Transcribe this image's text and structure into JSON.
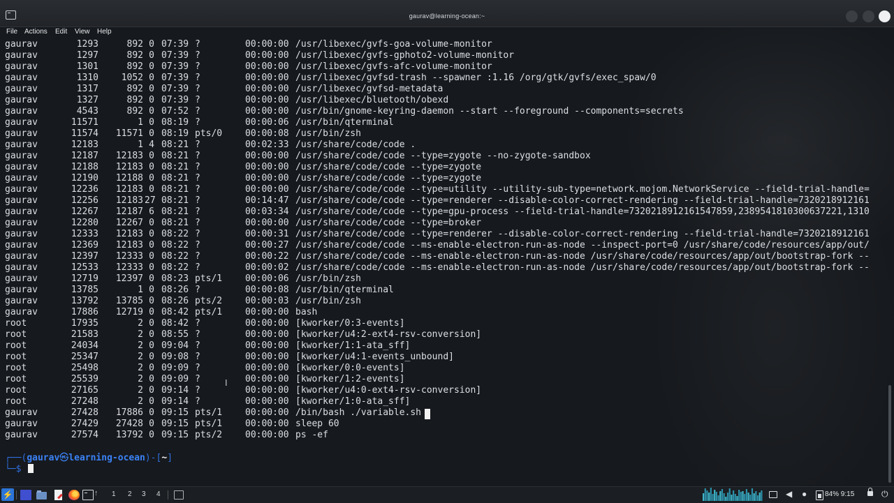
{
  "window": {
    "title": "gaurav@learning-ocean:~"
  },
  "menu": [
    "File",
    "Actions",
    "Edit",
    "View",
    "Help"
  ],
  "ps_rows": [
    [
      "gaurav",
      "1293",
      "892",
      "0",
      "07:39",
      "?",
      "00:00:00",
      "/usr/libexec/gvfs-goa-volume-monitor"
    ],
    [
      "gaurav",
      "1297",
      "892",
      "0",
      "07:39",
      "?",
      "00:00:00",
      "/usr/libexec/gvfs-gphoto2-volume-monitor"
    ],
    [
      "gaurav",
      "1301",
      "892",
      "0",
      "07:39",
      "?",
      "00:00:00",
      "/usr/libexec/gvfs-afc-volume-monitor"
    ],
    [
      "gaurav",
      "1310",
      "1052",
      "0",
      "07:39",
      "?",
      "00:00:00",
      "/usr/libexec/gvfsd-trash --spawner :1.16 /org/gtk/gvfs/exec_spaw/0"
    ],
    [
      "gaurav",
      "1317",
      "892",
      "0",
      "07:39",
      "?",
      "00:00:00",
      "/usr/libexec/gvfsd-metadata"
    ],
    [
      "gaurav",
      "1327",
      "892",
      "0",
      "07:39",
      "?",
      "00:00:00",
      "/usr/libexec/bluetooth/obexd"
    ],
    [
      "gaurav",
      "4543",
      "892",
      "0",
      "07:52",
      "?",
      "00:00:00",
      "/usr/bin/gnome-keyring-daemon --start --foreground --components=secrets"
    ],
    [
      "gaurav",
      "11571",
      "1",
      "0",
      "08:19",
      "?",
      "00:00:06",
      "/usr/bin/qterminal"
    ],
    [
      "gaurav",
      "11574",
      "11571",
      "0",
      "08:19",
      "pts/0",
      "00:00:08",
      "/usr/bin/zsh"
    ],
    [
      "gaurav",
      "12183",
      "1",
      "4",
      "08:21",
      "?",
      "00:02:33",
      "/usr/share/code/code ."
    ],
    [
      "gaurav",
      "12187",
      "12183",
      "0",
      "08:21",
      "?",
      "00:00:00",
      "/usr/share/code/code --type=zygote --no-zygote-sandbox"
    ],
    [
      "gaurav",
      "12188",
      "12183",
      "0",
      "08:21",
      "?",
      "00:00:00",
      "/usr/share/code/code --type=zygote"
    ],
    [
      "gaurav",
      "12190",
      "12188",
      "0",
      "08:21",
      "?",
      "00:00:00",
      "/usr/share/code/code --type=zygote"
    ],
    [
      "gaurav",
      "12236",
      "12183",
      "0",
      "08:21",
      "?",
      "00:00:00",
      "/usr/share/code/code --type=utility --utility-sub-type=network.mojom.NetworkService --field-trial-handle="
    ],
    [
      "gaurav",
      "12256",
      "12183",
      "27",
      "08:21",
      "?",
      "00:14:47",
      "/usr/share/code/code --type=renderer --disable-color-correct-rendering --field-trial-handle=7320218912161"
    ],
    [
      "gaurav",
      "12267",
      "12187",
      "6",
      "08:21",
      "?",
      "00:03:34",
      "/usr/share/code/code --type=gpu-process --field-trial-handle=7320218912161547859,2389541810300637221,1310"
    ],
    [
      "gaurav",
      "12280",
      "12267",
      "0",
      "08:21",
      "?",
      "00:00:00",
      "/usr/share/code/code --type=broker"
    ],
    [
      "gaurav",
      "12333",
      "12183",
      "0",
      "08:22",
      "?",
      "00:00:31",
      "/usr/share/code/code --type=renderer --disable-color-correct-rendering --field-trial-handle=7320218912161"
    ],
    [
      "gaurav",
      "12369",
      "12183",
      "0",
      "08:22",
      "?",
      "00:00:27",
      "/usr/share/code/code --ms-enable-electron-run-as-node --inspect-port=0 /usr/share/code/resources/app/out/"
    ],
    [
      "gaurav",
      "12397",
      "12333",
      "0",
      "08:22",
      "?",
      "00:00:22",
      "/usr/share/code/code --ms-enable-electron-run-as-node /usr/share/code/resources/app/out/bootstrap-fork --"
    ],
    [
      "gaurav",
      "12533",
      "12333",
      "0",
      "08:22",
      "?",
      "00:00:02",
      "/usr/share/code/code --ms-enable-electron-run-as-node /usr/share/code/resources/app/out/bootstrap-fork --"
    ],
    [
      "gaurav",
      "12719",
      "12397",
      "0",
      "08:23",
      "pts/1",
      "00:00:06",
      "/usr/bin/zsh"
    ],
    [
      "gaurav",
      "13785",
      "1",
      "0",
      "08:26",
      "?",
      "00:00:08",
      "/usr/bin/qterminal"
    ],
    [
      "gaurav",
      "13792",
      "13785",
      "0",
      "08:26",
      "pts/2",
      "00:00:03",
      "/usr/bin/zsh"
    ],
    [
      "gaurav",
      "17886",
      "12719",
      "0",
      "08:42",
      "pts/1",
      "00:00:00",
      "bash"
    ],
    [
      "root",
      "17935",
      "2",
      "0",
      "08:42",
      "?",
      "00:00:00",
      "[kworker/0:3-events]"
    ],
    [
      "root",
      "21583",
      "2",
      "0",
      "08:55",
      "?",
      "00:00:00",
      "[kworker/u4:2-ext4-rsv-conversion]"
    ],
    [
      "root",
      "24034",
      "2",
      "0",
      "09:04",
      "?",
      "00:00:00",
      "[kworker/1:1-ata_sff]"
    ],
    [
      "root",
      "25347",
      "2",
      "0",
      "09:08",
      "?",
      "00:00:00",
      "[kworker/u4:1-events_unbound]"
    ],
    [
      "root",
      "25498",
      "2",
      "0",
      "09:09",
      "?",
      "00:00:00",
      "[kworker/0:0-events]"
    ],
    [
      "root",
      "25539",
      "2",
      "0",
      "09:09",
      "?",
      "00:00:00",
      "[kworker/1:2-events]"
    ],
    [
      "root",
      "27165",
      "2",
      "0",
      "09:14",
      "?",
      "00:00:00",
      "[kworker/u4:0-ext4-rsv-conversion]"
    ],
    [
      "root",
      "27248",
      "2",
      "0",
      "09:14",
      "?",
      "00:00:00",
      "[kworker/1:0-ata_sff]"
    ],
    [
      "gaurav",
      "27428",
      "17886",
      "0",
      "09:15",
      "pts/1",
      "00:00:00",
      "/bin/bash ./variable.sh"
    ],
    [
      "gaurav",
      "27429",
      "27428",
      "0",
      "09:15",
      "pts/1",
      "00:00:00",
      "sleep 60"
    ],
    [
      "gaurav",
      "27574",
      "13792",
      "0",
      "09:15",
      "pts/2",
      "00:00:00",
      "ps -ef"
    ]
  ],
  "prompt": {
    "frame_open": "┌──(",
    "user": "gaurav",
    "at": "㉿",
    "host": "learning-ocean",
    "mid": ")-[",
    "dir": "~",
    "close": "]",
    "line2": "└─$ "
  },
  "taskbar": {
    "workspaces": [
      "1",
      "2",
      "3",
      "4"
    ],
    "battery": "84%",
    "clock": "9:15",
    "cpu_samples": [
      0.55,
      0.9,
      0.75,
      0.6,
      0.95,
      0.5,
      0.8,
      0.65,
      0.4,
      0.7,
      0.85,
      0.55,
      0.3,
      0.6,
      0.9,
      0.45,
      0.75,
      0.5,
      0.35,
      0.8,
      0.65,
      0.7,
      0.5,
      0.85,
      0.6,
      0.45,
      0.9,
      0.55,
      0.7,
      0.4,
      0.6,
      0.75
    ]
  }
}
